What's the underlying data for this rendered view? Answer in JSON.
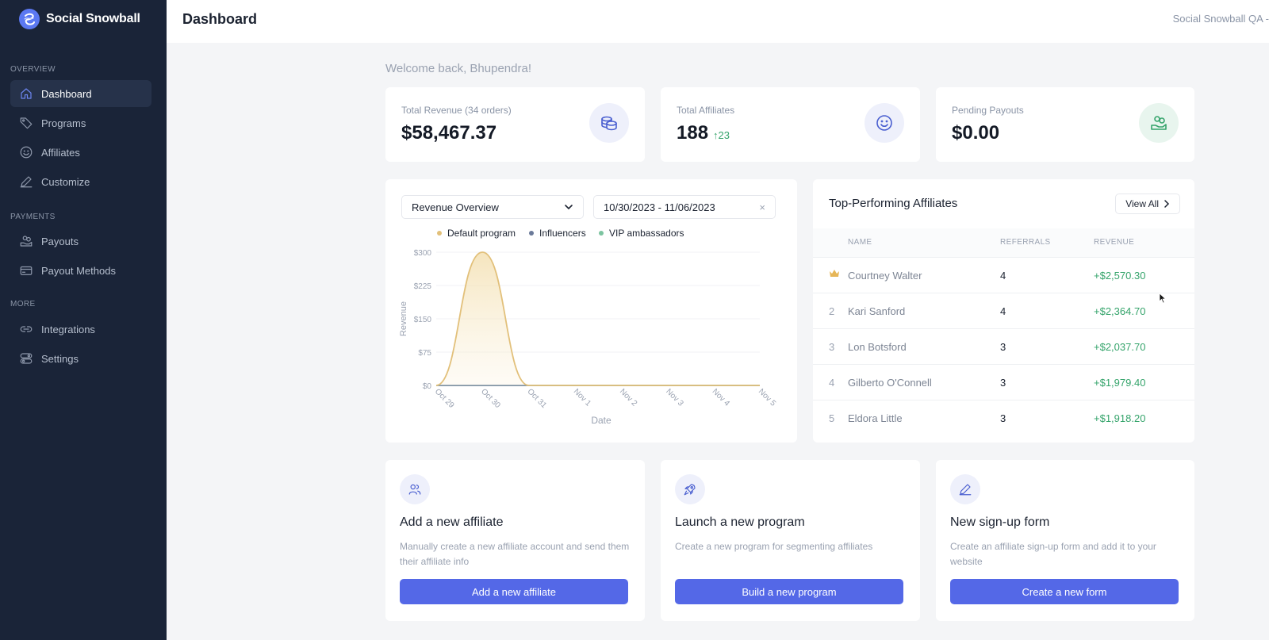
{
  "brand": {
    "name": "Social Snowball"
  },
  "header": {
    "title": "Dashboard",
    "account": "Social Snowball QA -"
  },
  "sidebar": {
    "sections": [
      {
        "label": "OVERVIEW",
        "items": [
          {
            "label": "Dashboard",
            "icon": "home-icon",
            "active": true
          },
          {
            "label": "Programs",
            "icon": "tag-icon"
          },
          {
            "label": "Affiliates",
            "icon": "smile-icon"
          },
          {
            "label": "Customize",
            "icon": "pen-icon"
          }
        ]
      },
      {
        "label": "PAYMENTS",
        "items": [
          {
            "label": "Payouts",
            "icon": "hand-coins-icon"
          },
          {
            "label": "Payout Methods",
            "icon": "card-icon"
          }
        ]
      },
      {
        "label": "MORE",
        "items": [
          {
            "label": "Integrations",
            "icon": "link-icon"
          },
          {
            "label": "Settings",
            "icon": "settings-icon"
          }
        ]
      }
    ]
  },
  "welcome": "Welcome back, Bhupendra!",
  "stats": [
    {
      "label": "Total Revenue (34 orders)",
      "value": "$58,467.37",
      "delta": "",
      "icon": "coins-icon",
      "icon_bg": "#eef0fb",
      "icon_color": "#4a5fd0"
    },
    {
      "label": "Total Affiliates",
      "value": "188",
      "delta": "↑23",
      "icon": "smile-icon",
      "icon_bg": "#eef0fb",
      "icon_color": "#4a5fd0"
    },
    {
      "label": "Pending Payouts",
      "value": "$0.00",
      "delta": "",
      "icon": "hand-coins-icon",
      "icon_bg": "#e8f5ee",
      "icon_color": "#35a46b"
    }
  ],
  "chart_panel": {
    "select_value": "Revenue Overview",
    "date_range": "10/30/2023 - 11/06/2023"
  },
  "chart_data": {
    "type": "area",
    "title": "",
    "xlabel": "Date",
    "ylabel": "Revenue",
    "categories": [
      "Oct 29",
      "Oct 30",
      "Oct 31",
      "Nov 1",
      "Nov 2",
      "Nov 3",
      "Nov 4",
      "Nov 5"
    ],
    "ylim": [
      0,
      300
    ],
    "yticks": [
      "$0",
      "$75",
      "$150",
      "$225",
      "$300"
    ],
    "legend_position": "top",
    "series": [
      {
        "name": "Default program",
        "color": "#e2c07a",
        "values": [
          0,
          300,
          0,
          0,
          0,
          0,
          0,
          0
        ]
      },
      {
        "name": "Influencers",
        "color": "#6b7a99",
        "values": [
          0,
          0,
          0,
          0,
          0,
          0,
          0,
          0
        ]
      },
      {
        "name": "VIP ambassadors",
        "color": "#7cc4a0",
        "values": [
          0,
          0,
          0,
          0,
          0,
          0,
          0,
          0
        ]
      }
    ]
  },
  "top_affiliates": {
    "title": "Top-Performing Affiliates",
    "view_all": "View All",
    "columns": [
      "NAME",
      "REFERRALS",
      "REVENUE"
    ],
    "rows": [
      {
        "rank": "crown",
        "name": "Courtney Walter",
        "referrals": "4",
        "revenue": "+$2,570.30"
      },
      {
        "rank": "2",
        "name": "Kari Sanford",
        "referrals": "4",
        "revenue": "+$2,364.70"
      },
      {
        "rank": "3",
        "name": "Lon Botsford",
        "referrals": "3",
        "revenue": "+$2,037.70"
      },
      {
        "rank": "4",
        "name": "Gilberto O'Connell",
        "referrals": "3",
        "revenue": "+$1,979.40"
      },
      {
        "rank": "5",
        "name": "Eldora Little",
        "referrals": "3",
        "revenue": "+$1,918.20"
      }
    ]
  },
  "actions": [
    {
      "icon": "users-icon",
      "title": "Add a new affiliate",
      "desc": "Manually create a new affiliate account and send them their affiliate info",
      "button": "Add a new affiliate"
    },
    {
      "icon": "rocket-icon",
      "title": "Launch a new program",
      "desc": "Create a new program for segmenting affiliates",
      "button": "Build a new program"
    },
    {
      "icon": "pen-icon",
      "title": "New sign-up form",
      "desc": "Create an affiliate sign-up form and add it to your website",
      "button": "Create a new form"
    }
  ]
}
